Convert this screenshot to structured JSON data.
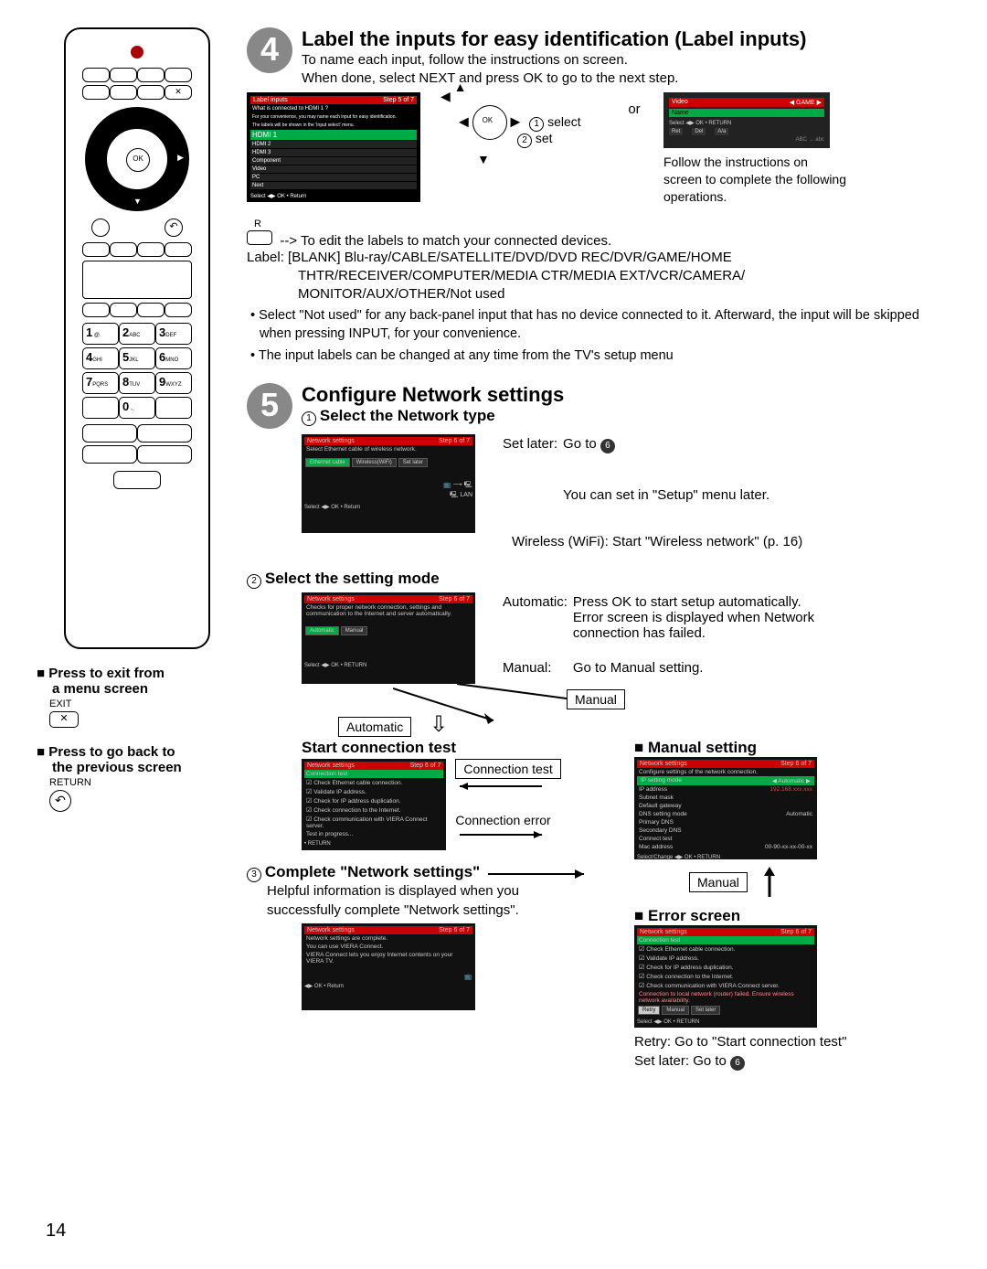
{
  "page_number": "14",
  "remote": {
    "ok": "OK",
    "keys": [
      "1 @.",
      "2 ABC",
      "3 DEF",
      "4 GHI",
      "5 JKL",
      "6 MNO",
      "7 PQRS",
      "8 TUV",
      "9 WXYZ",
      "",
      "0 -.",
      ""
    ],
    "hint1_a": "■ Press to exit from",
    "hint1_b": "a menu screen",
    "exit_label": "EXIT",
    "hint2_a": "■ Press to go back to",
    "hint2_b": "the previous screen",
    "return_label": "RETURN"
  },
  "step4": {
    "num": "4",
    "title": "Label the inputs for easy identification (Label inputs)",
    "line1": "To name each input, follow the instructions on screen.",
    "line2": "When done, select NEXT and press OK to go to the next step.",
    "screen_a": {
      "title": "Label inputs",
      "step": "Step 5 of 7",
      "q": "What is connected to HDMI 1 ?",
      "note1": "For your convenience, you may name each input for easy identification.",
      "note2": "The labels will be shown in the 'Input select' menu.",
      "rows": [
        "HDMI 1",
        "HDMI 2",
        "HDMI 3",
        "Component",
        "Video",
        "PC",
        "Next"
      ],
      "footer": "Select ◀▶ OK • Return"
    },
    "select": "select",
    "set": "set",
    "or": "or",
    "follow": "Follow the instructions on screen to complete the following operations.",
    "osd": {
      "title": "Video",
      "tag": "GAME",
      "name": "Name",
      "footer": "Select ◀▶ OK • RETURN",
      "hint": "ABC → abc"
    },
    "r_label": "R",
    "r_line": "--> To edit the labels to match your connected devices.",
    "label_line1": "Label:  [BLANK] Blu-ray/CABLE/SATELLITE/DVD/DVD REC/DVR/GAME/HOME",
    "label_line2": "THTR/RECEIVER/COMPUTER/MEDIA CTR/MEDIA EXT/VCR/CAMERA/",
    "label_line3": "MONITOR/AUX/OTHER/Not used",
    "b1": "• Select \"Not used\" for any back-panel input that has no device connected to it. Afterward, the input will be skipped when pressing INPUT, for your convenience.",
    "b2": "• The input labels can be changed at any time from the TV's setup menu"
  },
  "step5": {
    "num": "5",
    "title": "Configure Network settings",
    "sub1": "Select the Network type",
    "screen_a": {
      "title": "Network settings",
      "step": "Step 6 of 7",
      "q": "Select Ethernet cable of wireless network.",
      "btns": [
        "Ethernet cable",
        "Wireless(WiFi)",
        "Set later"
      ],
      "footer": "Select ◀▶ OK • Return"
    },
    "right1_a": "Set later:",
    "right1_b": "Go to ",
    "right1_c": "You can set in \"Setup\" menu later.",
    "right1_d": "Wireless (WiFi): Start \"Wireless network\" (p. 16)",
    "sub2": "Select the setting mode",
    "screen_b": {
      "title": "Network settings",
      "step": "Step 6 of 7",
      "q": "Checks for proper network connection, settings and communication to the Internet and server automatically.",
      "btns": [
        "Automatic",
        "Manual"
      ],
      "footer": "Select ◀▶ OK • RETURN"
    },
    "right2_a": "Automatic:",
    "right2_b": "Press OK to start setup automatically. Error screen is displayed when Network connection has failed.",
    "right2_c": "Manual:",
    "right2_d": "Go to Manual setting.",
    "box_manual": "Manual",
    "box_auto": "Automatic",
    "sub_start": "Start connection test",
    "screen_c": {
      "title": "Network settings",
      "step": "Step 6 of 7",
      "head": "Connection test",
      "items": [
        "Check Ethernet cable connection.",
        "Validate IP address.",
        "Check for IP address duplication.",
        "Check connection to the Internet.",
        "Check communication with VIERA Connect server."
      ],
      "prog": "Test in progress...",
      "footer": "• RETURN"
    },
    "box_conntest": "Connection test",
    "conn_err": "Connection error",
    "sub3": "Complete \"Network settings\"",
    "sub3_line1": "Helpful information is displayed when you",
    "sub3_line2": "successfully complete \"Network settings\".",
    "screen_d": {
      "title": "Network settings",
      "step": "Step 6 of 7",
      "msg1": "Network settings are complete.",
      "msg2": "You can use VIERA Connect.",
      "msg3": "VIERA Connect lets you enjoy Internet contents on your VIERA TV.",
      "footer": "◀▶ OK • Return"
    },
    "manual_head": "■ Manual setting",
    "screen_manual": {
      "title": "Network settings",
      "step": "Step 6 of 7",
      "q": "Configure settings of the network connection.",
      "rows": [
        [
          "IP setting mode",
          "Automatic"
        ],
        [
          "IP address",
          "192.168.xxx.xxx"
        ],
        [
          "Subnet mask",
          ""
        ],
        [
          "Default gateway",
          ""
        ],
        [
          "DNS setting mode",
          "Automatic"
        ],
        [
          "Primary DNS",
          ""
        ],
        [
          "Secondary DNS",
          ""
        ],
        [
          "Connect test",
          ""
        ],
        [
          "Mac address",
          "00-90-xx-xx-00-xx"
        ]
      ],
      "footer": "Select/Change ◀▶ OK • RETURN"
    },
    "box_manual2": "Manual",
    "err_head": "■ Error screen",
    "screen_err": {
      "title": "Network settings",
      "step": "Step 6 of 7",
      "head": "Connection test",
      "items": [
        "Check Ethernet cable connection.",
        "Validate IP address.",
        "Check for IP address duplication.",
        "Check connection to the Internet.",
        "Check communication with VIERA Connect server."
      ],
      "fail": "Connection to local network (router) failed. Ensure wireless network availability.",
      "btns": [
        "Retry",
        "Manual",
        "Set later"
      ],
      "footer": "Select ◀▶ OK • RETURN"
    },
    "retry": "Retry: Go to \"Start connection test\"",
    "setlater": "Set later: Go to "
  }
}
